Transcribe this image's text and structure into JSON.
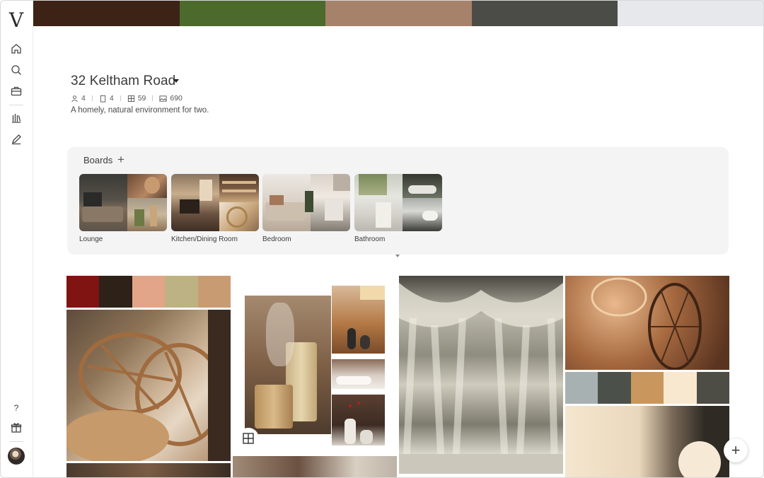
{
  "app": {
    "logo_text": "V"
  },
  "palette_strip": [
    "#3d2216",
    "#4b6a2c",
    "#a7826a",
    "#4b4c47",
    "#e6e8eb"
  ],
  "project": {
    "title": "32 Keltham Road",
    "stats": {
      "people": "4",
      "rooms": "4",
      "boards_items": "59",
      "images": "690"
    },
    "description": "A homely, natural environment for two."
  },
  "boards": {
    "label": "Boards",
    "add_symbol": "+",
    "items": [
      {
        "label": "Lounge"
      },
      {
        "label": "Kitchen/Dining Room"
      },
      {
        "label": "Bedroom"
      },
      {
        "label": "Bathroom"
      }
    ]
  },
  "moodboard": {
    "swatches_top_left": [
      "#7f1412",
      "#2e2118",
      "#e2a589",
      "#bdb284",
      "#c99b72"
    ],
    "swatches_right": [
      "#a7b1b2",
      "#4b514a",
      "#c9975d",
      "#f8e8cf",
      "#4d4c45"
    ]
  },
  "sidebar": {
    "help_label": "?"
  },
  "fab": {
    "add_symbol": "+"
  }
}
